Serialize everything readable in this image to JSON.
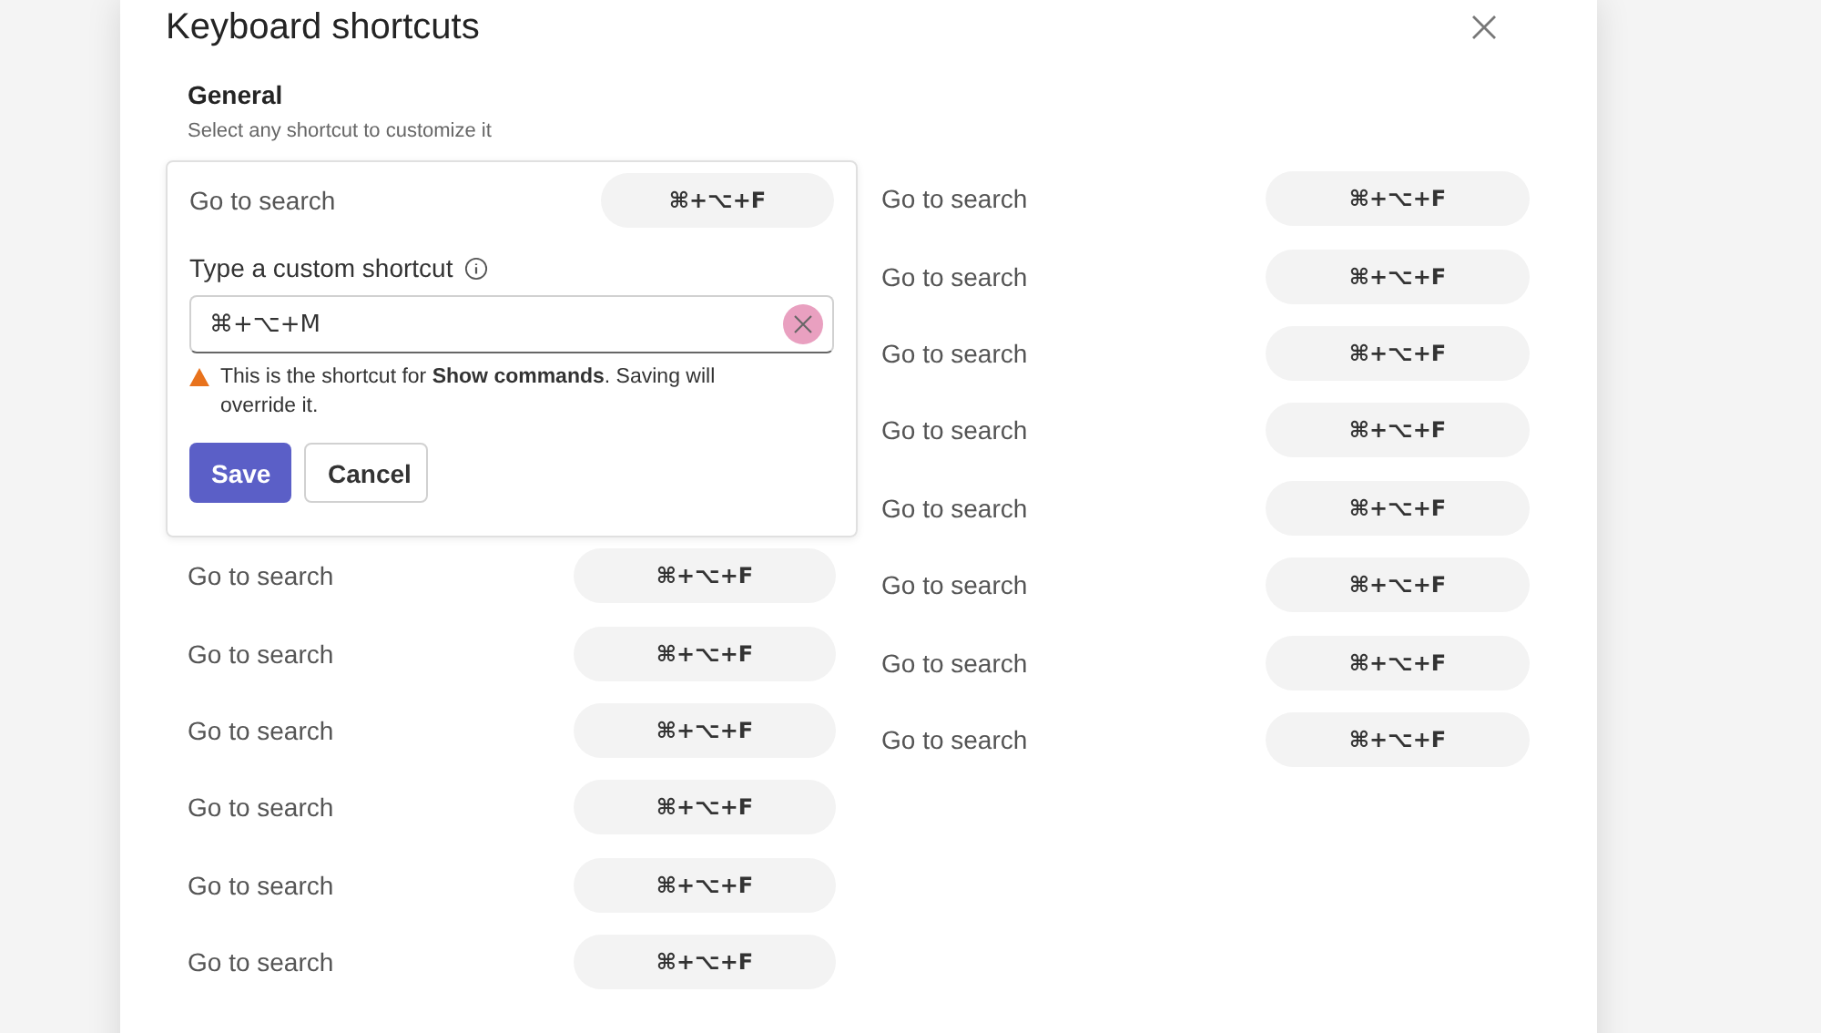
{
  "dialog": {
    "title": "Keyboard shortcuts"
  },
  "section": {
    "title": "General",
    "hint": "Select any shortcut to customize it"
  },
  "editor": {
    "action": "Go to search",
    "keys": "⌘+⌥+F",
    "field_label": "Type a custom shortcut",
    "value": "⌘+⌥+M",
    "clear_hovered": true,
    "warning": "This is the shortcut for **Show commands**. Saving will override it.",
    "buttons": [
      {
        "label": "Save",
        "kind": "primary"
      },
      {
        "label": "Cancel",
        "kind": "secondary"
      }
    ]
  },
  "left_rows": [
    {
      "action": "Go to search",
      "keys": "⌘+⌥+F"
    },
    {
      "action": "Go to search",
      "keys": "⌘+⌥+F"
    },
    {
      "action": "Go to search",
      "keys": "⌘+⌥+F"
    },
    {
      "action": "Go to search",
      "keys": "⌘+⌥+F"
    },
    {
      "action": "Go to search",
      "keys": "⌘+⌥+F"
    },
    {
      "action": "Go to search",
      "keys": "⌘+⌥+F"
    }
  ],
  "right_rows": [
    {
      "action": "Go to search",
      "keys": "⌘+⌥+F"
    },
    {
      "action": "Go to search",
      "keys": "⌘+⌥+F"
    },
    {
      "action": "Go to search",
      "keys": "⌘+⌥+F"
    },
    {
      "action": "Go to search",
      "keys": "⌘+⌥+F"
    },
    {
      "action": "Go to search",
      "keys": "⌘+⌥+F"
    },
    {
      "action": "Go to search",
      "keys": "⌘+⌥+F"
    },
    {
      "action": "Go to search",
      "keys": "⌘+⌥+F"
    },
    {
      "action": "Go to search",
      "keys": "⌘+⌥+F"
    }
  ]
}
